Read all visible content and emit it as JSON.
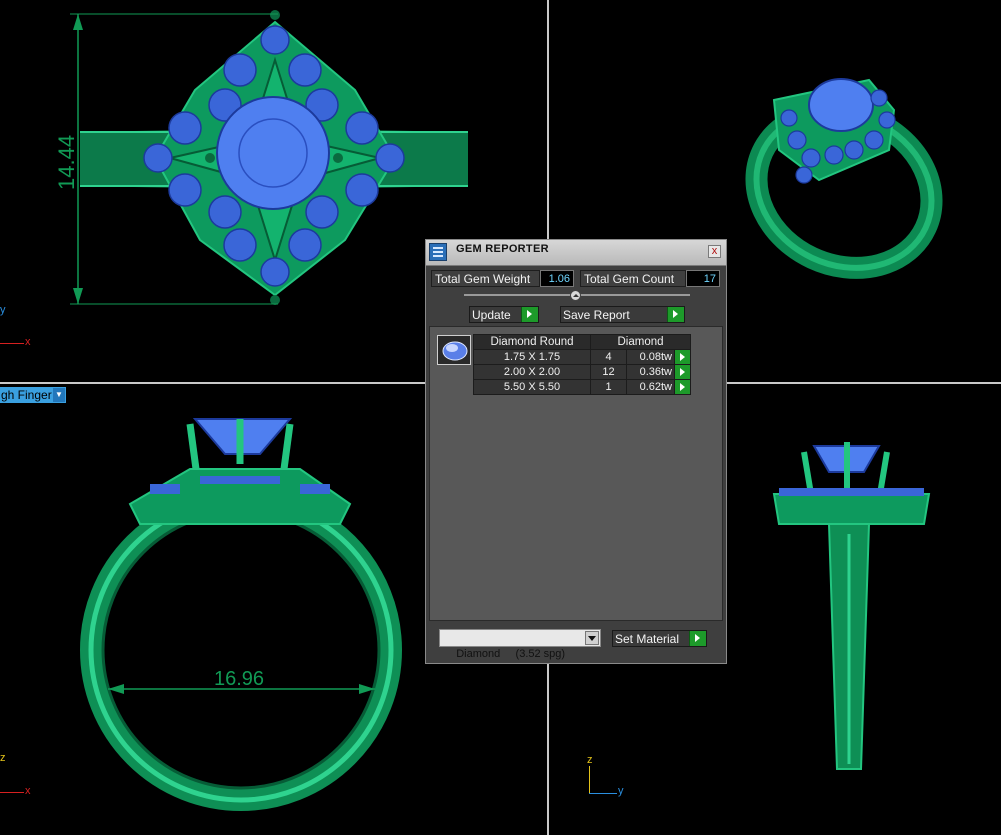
{
  "viewports": {
    "top": {
      "dimension": "14.44",
      "axis_x": "x",
      "axis_y": "y"
    },
    "front": {
      "dimension": "16.96",
      "axis_x": "x",
      "axis_z": "z"
    },
    "side": {
      "axis_y": "y",
      "axis_z": "z"
    },
    "finger_select": {
      "value": "gh Finger"
    }
  },
  "gem_reporter": {
    "title": "GEM REPORTER",
    "close_glyph": "x",
    "total_weight_label": "Total Gem Weight",
    "total_weight_value": "1.06",
    "total_count_label": "Total Gem Count",
    "total_count_value": "17",
    "update_label": "Update",
    "save_label": "Save Report",
    "table": {
      "headers": [
        "Diamond Round",
        "Diamond"
      ],
      "rows": [
        {
          "size": "1.75 X 1.75",
          "count": "4",
          "weight": "0.08tw"
        },
        {
          "size": "2.00 X 2.00",
          "count": "12",
          "weight": "0.36tw"
        },
        {
          "size": "5.50 X 5.50",
          "count": "1",
          "weight": "0.62tw"
        }
      ]
    },
    "material": "Diamond     (3.52 spg)",
    "set_material_label": "Set Material"
  },
  "colors": {
    "metal": "#0f8f5a",
    "gem": "#3a66d8",
    "dimension": "#119a55",
    "separator": "#c9c9c9",
    "action_green": "#1d9a2a"
  }
}
